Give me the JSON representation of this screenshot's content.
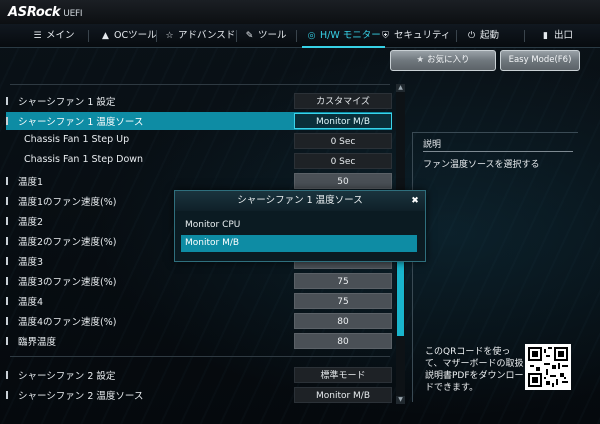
{
  "brand": {
    "name": "ASRock",
    "suffix": "UEFI"
  },
  "menu": [
    {
      "label": "メイン",
      "icon": "list-icon"
    },
    {
      "label": "OCツール",
      "icon": "rocket-icon"
    },
    {
      "label": "アドバンスド",
      "icon": "star-icon"
    },
    {
      "label": "ツール",
      "icon": "wrench-icon"
    },
    {
      "label": "H/W モニター",
      "icon": "monitor-icon",
      "active": true
    },
    {
      "label": "セキュリティ",
      "icon": "shield-icon"
    },
    {
      "label": "起動",
      "icon": "power-icon"
    },
    {
      "label": "出口",
      "icon": "exit-icon"
    }
  ],
  "buttons": {
    "favorites": "お気に入り",
    "easy_mode": "Easy Mode(F6)"
  },
  "settings": [
    {
      "label": "シャーシファン 1 設定",
      "value": "カスタマイズ",
      "style": "dark"
    },
    {
      "label": "シャーシファン 1 温度ソース",
      "value": "Monitor M/B",
      "style": "sel",
      "highlight": true
    },
    {
      "label": "Chassis Fan 1 Step Up",
      "value": "0 Sec",
      "style": "dark",
      "sub": true
    },
    {
      "label": "Chassis Fan 1 Step Down",
      "value": "0 Sec",
      "style": "dark",
      "sub": true
    },
    {
      "label": "温度1",
      "value": "50",
      "style": "grey"
    },
    {
      "label": "温度1のファン速度(%)",
      "value": "",
      "style": "grey"
    },
    {
      "label": "温度2",
      "value": "",
      "style": "grey"
    },
    {
      "label": "温度2のファン速度(%)",
      "value": "",
      "style": "grey"
    },
    {
      "label": "温度3",
      "value": "",
      "style": "grey"
    },
    {
      "label": "温度3のファン速度(%)",
      "value": "75",
      "style": "grey"
    },
    {
      "label": "温度4",
      "value": "75",
      "style": "grey"
    },
    {
      "label": "温度4のファン速度(%)",
      "value": "80",
      "style": "grey"
    },
    {
      "label": "臨界温度",
      "value": "80",
      "style": "grey"
    },
    {
      "label": "シャーシファン 2 設定",
      "value": "標準モード",
      "style": "dark"
    },
    {
      "label": "シャーシファン 2 温度ソース",
      "value": "Monitor M/B",
      "style": "dark"
    }
  ],
  "description": {
    "title": "説明",
    "text": "ファン温度ソースを選択する",
    "qr_text": "このQRコードを使って、マザーボードの取扱説明書PDFをダウンロードできます。"
  },
  "popup": {
    "title": "シャーシファン 1 温度ソース",
    "options": [
      "Monitor CPU",
      "Monitor M/B"
    ],
    "selected": 1
  },
  "colors": {
    "accent": "#37d1e6",
    "highlight": "#0e8ca4"
  }
}
